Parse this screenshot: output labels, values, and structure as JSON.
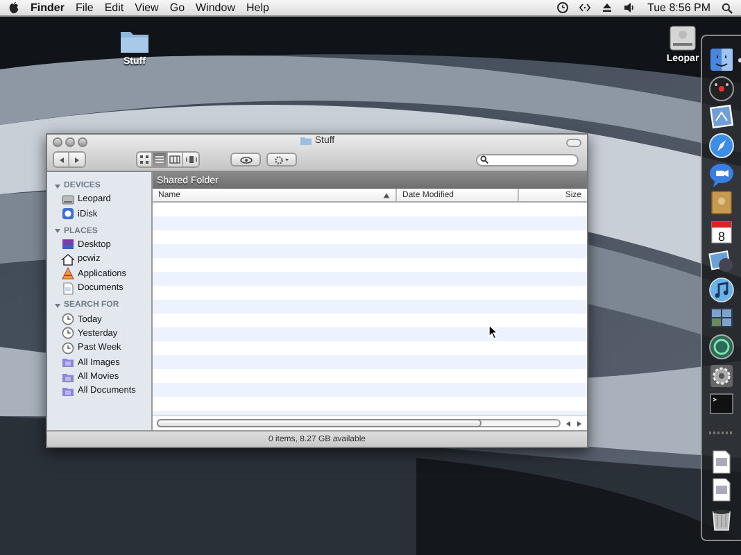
{
  "menubar": {
    "app": "Finder",
    "menus": [
      "File",
      "Edit",
      "View",
      "Go",
      "Window",
      "Help"
    ],
    "extras": [
      {
        "kind": "timemachine"
      },
      {
        "kind": "remote"
      },
      {
        "kind": "eject"
      },
      {
        "kind": "volume"
      }
    ],
    "clock": "Tue 8:56 PM"
  },
  "desktop_icons": [
    {
      "kind": "folder",
      "label": "Stuff"
    },
    {
      "kind": "drive",
      "label": "Leopar"
    }
  ],
  "window": {
    "title": "Stuff",
    "view_modes": [
      {
        "kind": "icon",
        "selected": false
      },
      {
        "kind": "list",
        "selected": true
      },
      {
        "kind": "column",
        "selected": false
      },
      {
        "kind": "coverflow",
        "selected": false
      }
    ],
    "sidebar": [
      {
        "heading": "DEVICES",
        "expanded": true,
        "items": [
          {
            "kind": "drive",
            "label": "Leopard"
          },
          {
            "kind": "idisk",
            "label": "iDisk"
          }
        ]
      },
      {
        "heading": "PLACES",
        "expanded": true,
        "items": [
          {
            "kind": "desktop",
            "label": "Desktop"
          },
          {
            "kind": "home",
            "label": "pcwiz"
          },
          {
            "kind": "applications",
            "label": "Applications"
          },
          {
            "kind": "documents",
            "label": "Documents"
          }
        ]
      },
      {
        "heading": "SEARCH FOR",
        "expanded": true,
        "items": [
          {
            "kind": "clock",
            "label": "Today"
          },
          {
            "kind": "clock",
            "label": "Yesterday"
          },
          {
            "kind": "clock",
            "label": "Past Week"
          },
          {
            "kind": "smartfolder",
            "label": "All Images"
          },
          {
            "kind": "smartfolder",
            "label": "All Movies"
          },
          {
            "kind": "smartfolder",
            "label": "All Documents"
          }
        ]
      }
    ],
    "banner": "Shared Folder",
    "columns": [
      {
        "label": "Name",
        "sorted": true
      },
      {
        "label": "Date Modified",
        "sorted": false
      },
      {
        "label": "Size",
        "sorted": false
      }
    ],
    "status": "0 items, 8.27 GB available"
  },
  "dock": [
    {
      "kind": "finder",
      "running": true
    },
    {
      "kind": "dashboard",
      "running": false
    },
    {
      "kind": "mail",
      "running": false
    },
    {
      "kind": "safari",
      "running": false
    },
    {
      "kind": "ichat",
      "running": false
    },
    {
      "kind": "addressbook",
      "running": false
    },
    {
      "kind": "calendar",
      "running": false,
      "day": "8"
    },
    {
      "kind": "iphoto",
      "running": false
    },
    {
      "kind": "itunes",
      "running": false
    },
    {
      "kind": "spaces",
      "running": false
    },
    {
      "kind": "timemachine",
      "running": false
    },
    {
      "kind": "prefs",
      "running": false
    },
    {
      "kind": "terminal",
      "running": false
    },
    {
      "kind": "separator",
      "running": false
    },
    {
      "kind": "document",
      "running": false
    },
    {
      "kind": "document",
      "running": false
    },
    {
      "kind": "trash",
      "running": false
    }
  ]
}
